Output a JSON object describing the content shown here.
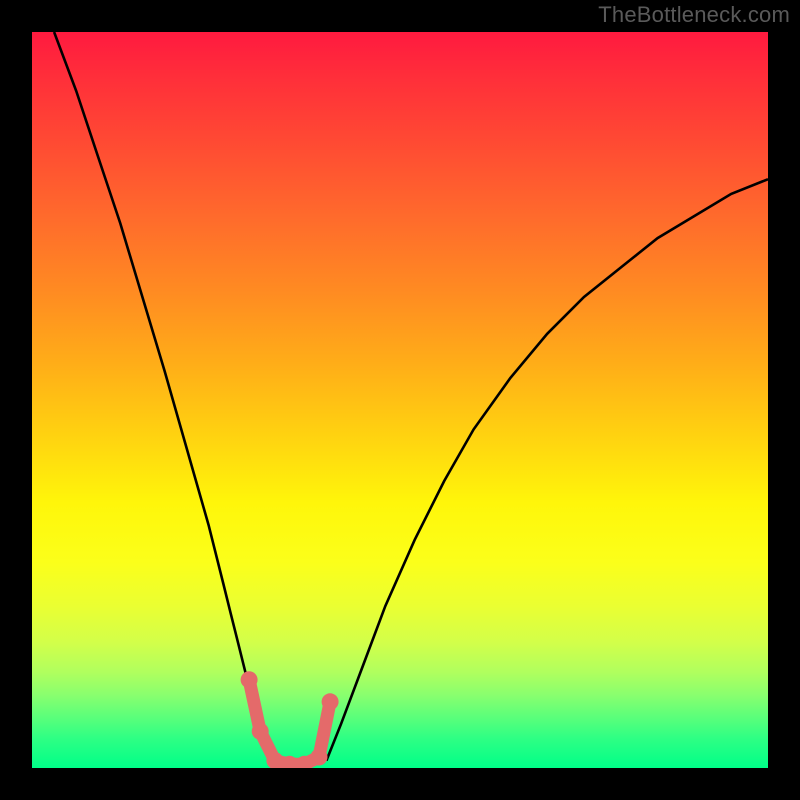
{
  "watermark": "TheBottleneck.com",
  "colors": {
    "page_bg": "#000000",
    "curve": "#000000",
    "marker_stroke": "#e46a6a",
    "marker_fill": "#e46a6a",
    "gradient_top": "#ff1a3f",
    "gradient_bottom": "#00ff88"
  },
  "chart_data": {
    "type": "line",
    "title": "",
    "xlabel": "",
    "ylabel": "",
    "xlim": [
      0,
      100
    ],
    "ylim": [
      0,
      100
    ],
    "notes": "Background is a vertical heat gradient (red at top = 100, green at bottom = 0); two black curves descend into a V-shaped valley whose floor is highlighted by a thick coral segment with dots. Axis tick labels are not visible in the original image; values are estimated from plot geometry out of 0–100.",
    "series": [
      {
        "name": "left-curve",
        "x": [
          3,
          6,
          9,
          12,
          15,
          18,
          20,
          22,
          24,
          26,
          27,
          28,
          29,
          30,
          31,
          32,
          33
        ],
        "y": [
          100,
          92,
          83,
          74,
          64,
          54,
          47,
          40,
          33,
          25,
          21,
          17,
          13,
          10,
          7,
          4,
          1
        ]
      },
      {
        "name": "right-curve",
        "x": [
          40,
          42,
          45,
          48,
          52,
          56,
          60,
          65,
          70,
          75,
          80,
          85,
          90,
          95,
          100
        ],
        "y": [
          1,
          6,
          14,
          22,
          31,
          39,
          46,
          53,
          59,
          64,
          68,
          72,
          75,
          78,
          80
        ]
      },
      {
        "name": "valley-highlight",
        "x": [
          29.5,
          31,
          33,
          35,
          37,
          39,
          40.5
        ],
        "y": [
          12,
          5,
          1,
          0.5,
          0.5,
          1.5,
          9
        ]
      }
    ],
    "markers": [
      {
        "x": 29.5,
        "y": 12
      },
      {
        "x": 31,
        "y": 5
      },
      {
        "x": 33,
        "y": 1
      },
      {
        "x": 35,
        "y": 0.5
      },
      {
        "x": 37,
        "y": 0.5
      },
      {
        "x": 39,
        "y": 1.5
      },
      {
        "x": 40.5,
        "y": 9
      }
    ]
  }
}
